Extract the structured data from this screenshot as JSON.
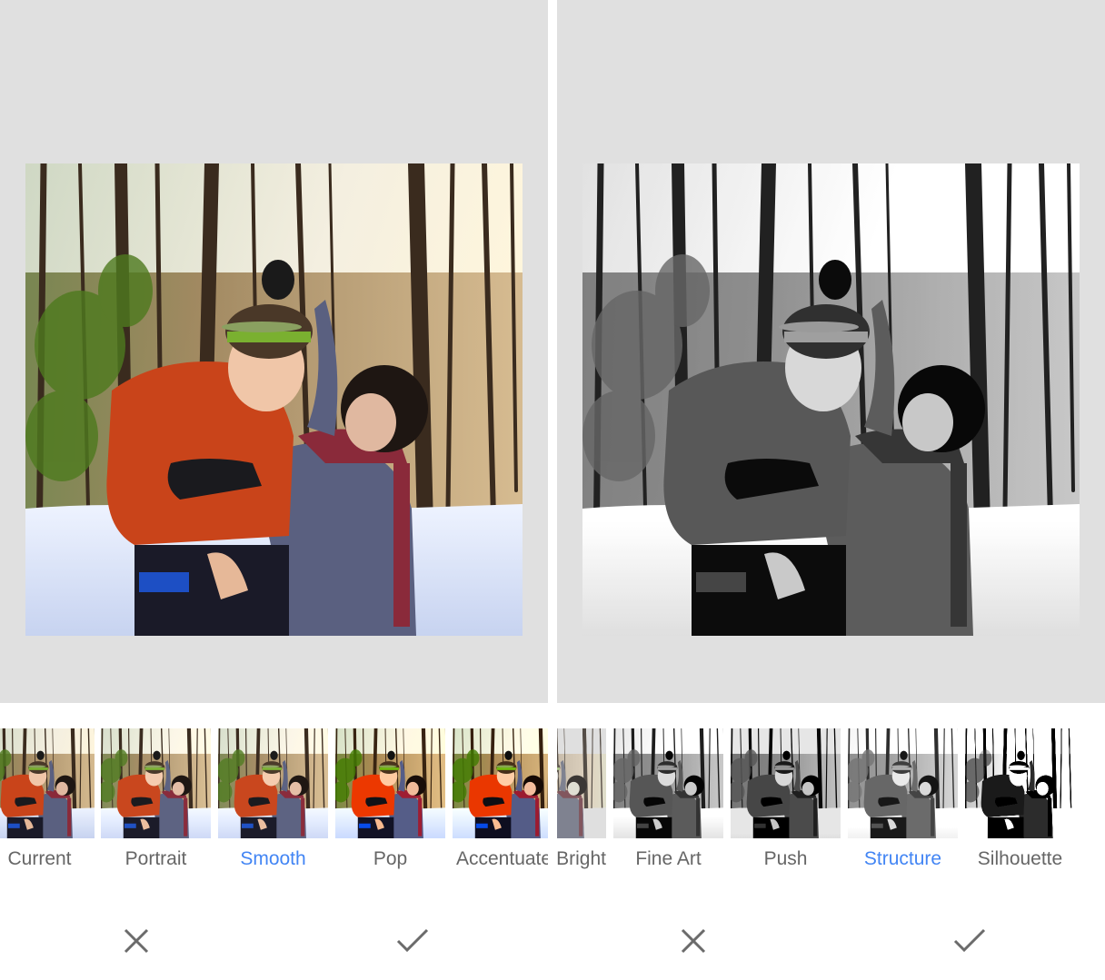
{
  "left_panel": {
    "filters": [
      {
        "label": "Current",
        "active": false
      },
      {
        "label": "Portrait",
        "active": false
      },
      {
        "label": "Smooth",
        "active": true
      },
      {
        "label": "Pop",
        "active": false
      },
      {
        "label": "Accentuate",
        "active": false
      }
    ],
    "actions": {
      "cancel_icon": "close-icon",
      "apply_icon": "check-icon"
    }
  },
  "right_panel": {
    "filters": [
      {
        "label": "Bright",
        "active": false
      },
      {
        "label": "Fine Art",
        "active": false
      },
      {
        "label": "Push",
        "active": false
      },
      {
        "label": "Structure",
        "active": true
      },
      {
        "label": "Silhouette",
        "active": false
      }
    ],
    "actions": {
      "cancel_icon": "close-icon",
      "apply_icon": "check-icon"
    }
  },
  "colors": {
    "active_label": "#4285f4",
    "inactive_label": "#666666",
    "preview_background": "#e0e0e0",
    "icon": "#6b6b6b"
  }
}
